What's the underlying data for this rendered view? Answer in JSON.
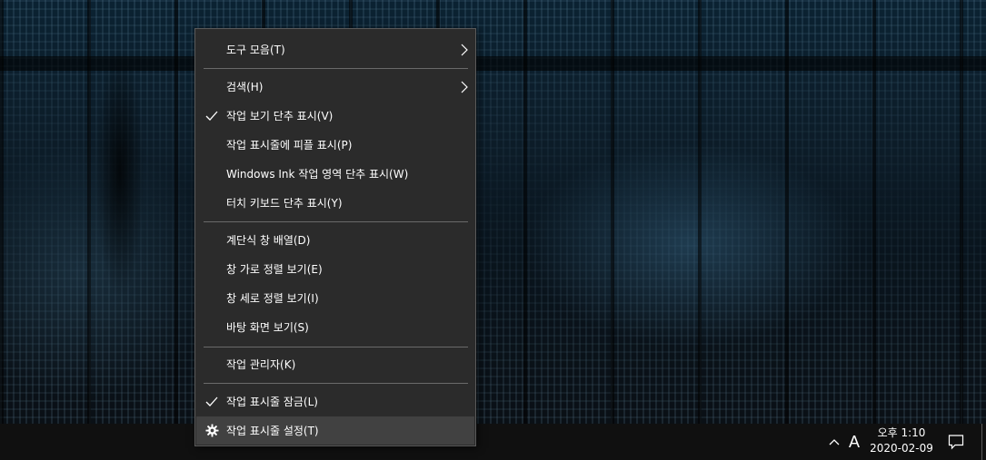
{
  "context_menu": {
    "items": [
      {
        "label": "도구 모음(T)",
        "checked": false,
        "submenu": true
      },
      {
        "label": "검색(H)",
        "checked": false,
        "submenu": true
      },
      {
        "label": "작업 보기 단추 표시(V)",
        "checked": true,
        "submenu": false
      },
      {
        "label": "작업 표시줄에 피플 표시(P)",
        "checked": false,
        "submenu": false
      },
      {
        "label": "Windows Ink 작업 영역 단추 표시(W)",
        "checked": false,
        "submenu": false
      },
      {
        "label": "터치 키보드 단추 표시(Y)",
        "checked": false,
        "submenu": false
      },
      {
        "label": "계단식 창 배열(D)",
        "checked": false,
        "submenu": false
      },
      {
        "label": "창 가로 정렬 보기(E)",
        "checked": false,
        "submenu": false
      },
      {
        "label": "창 세로 정렬 보기(I)",
        "checked": false,
        "submenu": false
      },
      {
        "label": "바탕 화면 보기(S)",
        "checked": false,
        "submenu": false
      },
      {
        "label": "작업 관리자(K)",
        "checked": false,
        "submenu": false
      },
      {
        "label": "작업 표시줄 잠금(L)",
        "checked": true,
        "submenu": false
      },
      {
        "label": "작업 표시줄 설정(T)",
        "checked": false,
        "submenu": false,
        "icon": "gear-icon",
        "highlighted": true
      }
    ]
  },
  "taskbar": {
    "ime_indicator": "A",
    "clock": {
      "time": "오후 1:10",
      "date": "2020-02-09"
    },
    "tray_icons": [
      "chevron-up-icon",
      "notification-icon"
    ]
  },
  "colors": {
    "menu_bg": "#2b2b2b",
    "menu_hover": "#414141",
    "menu_text": "#ffffff",
    "taskbar_bg": "#101010"
  }
}
